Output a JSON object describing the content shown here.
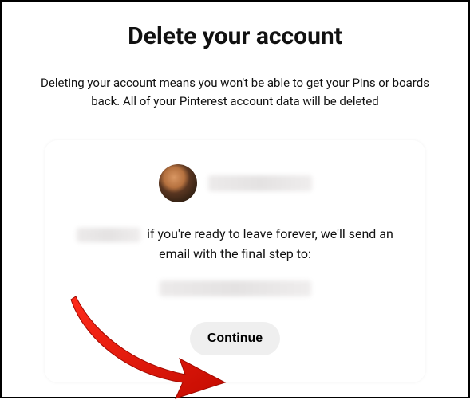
{
  "title": "Delete your account",
  "description": "Deleting your account means you won't be able to get your Pins or boards back. All of your Pinterest account data will be deleted",
  "card": {
    "message": "if you're ready to leave forever, we'll send an email with the final step to:",
    "continue_label": "Continue"
  }
}
